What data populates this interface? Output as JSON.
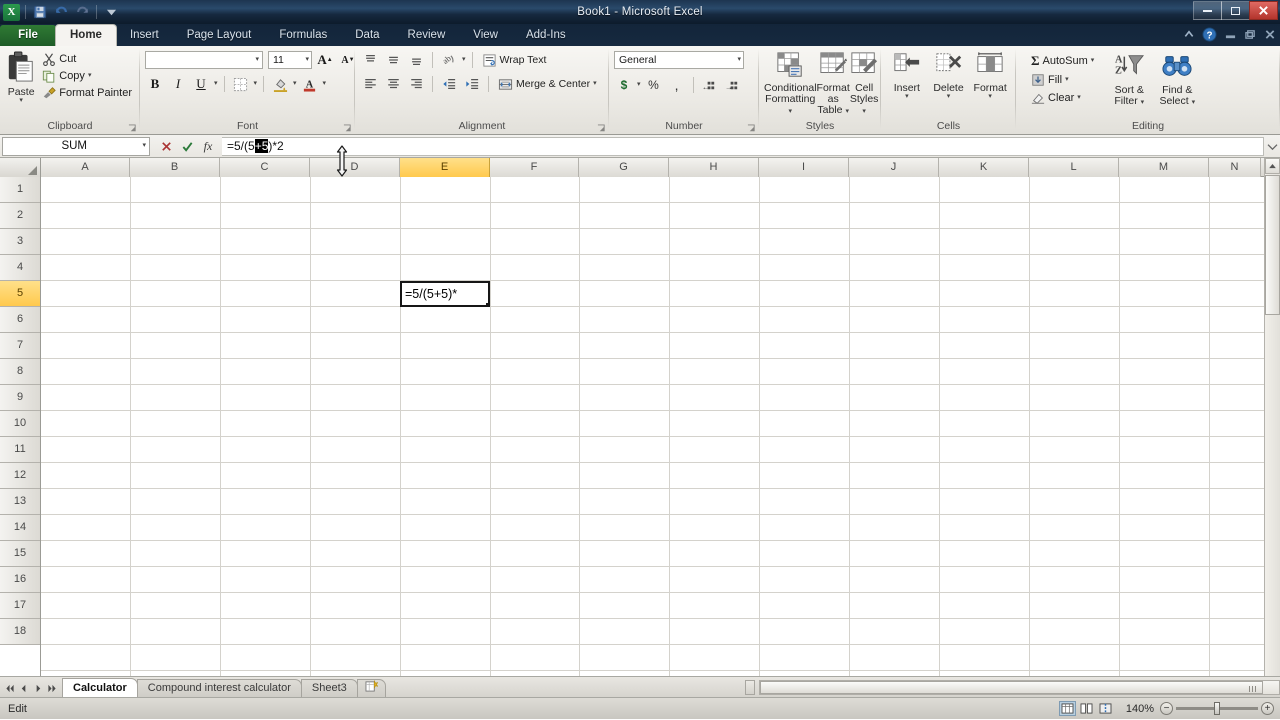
{
  "window": {
    "title": "Book1 - Microsoft Excel",
    "minimize": "–",
    "restore": "❐",
    "close": "✕"
  },
  "qat": {
    "logo": "X",
    "items": [
      {
        "name": "save-icon",
        "label": "Save"
      },
      {
        "name": "undo-icon",
        "label": "Undo"
      },
      {
        "name": "redo-icon",
        "label": "Redo"
      },
      {
        "name": "customize-qat-icon",
        "label": "Customize Quick Access Toolbar"
      }
    ]
  },
  "ribbon_tabs": {
    "file": "File",
    "items": [
      {
        "label": "Home",
        "active": true
      },
      {
        "label": "Insert",
        "active": false
      },
      {
        "label": "Page Layout",
        "active": false
      },
      {
        "label": "Formulas",
        "active": false
      },
      {
        "label": "Data",
        "active": false
      },
      {
        "label": "Review",
        "active": false
      },
      {
        "label": "View",
        "active": false
      },
      {
        "label": "Add-Ins",
        "active": false
      }
    ],
    "right_icons": [
      {
        "name": "minimize-ribbon-icon",
        "label": "Minimize the Ribbon"
      },
      {
        "name": "help-icon",
        "label": "Microsoft Excel Help"
      },
      {
        "name": "workbook-minimize-icon",
        "label": "Minimize Window"
      },
      {
        "name": "workbook-restore-icon",
        "label": "Restore Window"
      },
      {
        "name": "workbook-close-icon",
        "label": "Close Window"
      }
    ]
  },
  "ribbon": {
    "clipboard": {
      "title": "Clipboard",
      "paste": "Paste",
      "cut": "Cut",
      "copy": "Copy",
      "format_painter": "Format Painter"
    },
    "font": {
      "title": "Font",
      "font_name": "",
      "font_size": "11",
      "grow_font": "A",
      "shrink_font": "A",
      "bold": "B",
      "italic": "I",
      "underline": "U"
    },
    "alignment": {
      "title": "Alignment",
      "wrap_text": "Wrap Text",
      "merge_center": "Merge & Center"
    },
    "number": {
      "title": "Number",
      "format": "General",
      "currency": "$",
      "percent": "%",
      "comma": ",",
      "increase_decimal": "Increase Decimal",
      "decrease_decimal": "Decrease Decimal"
    },
    "styles": {
      "title": "Styles",
      "conditional_formatting": "Conditional\nFormatting",
      "conditional_formatting_l1": "Conditional",
      "conditional_formatting_l2": "Formatting",
      "format_as_table_l1": "Format",
      "format_as_table_l2": "as Table",
      "cell_styles_l1": "Cell",
      "cell_styles_l2": "Styles"
    },
    "cells": {
      "title": "Cells",
      "insert": "Insert",
      "delete": "Delete",
      "format": "Format"
    },
    "editing": {
      "title": "Editing",
      "autosum": "AutoSum",
      "fill": "Fill",
      "clear": "Clear",
      "sort_filter_l1": "Sort &",
      "sort_filter_l2": "Filter",
      "find_select_l1": "Find &",
      "find_select_l2": "Select"
    }
  },
  "formula_bar": {
    "name_box": "SUM",
    "formula_prefix": "=5/(5",
    "formula_selected": "+5",
    "formula_suffix": ")*2",
    "full_formula": "=5/(5+5)*2",
    "cancel_icon": "✕",
    "enter_icon": "✓",
    "fx_icon": "fx"
  },
  "grid": {
    "columns": [
      "A",
      "B",
      "C",
      "D",
      "E",
      "F",
      "G",
      "H",
      "I",
      "J",
      "K",
      "L",
      "M",
      "N"
    ],
    "selected_column": "E",
    "rows": [
      "1",
      "2",
      "3",
      "4",
      "5",
      "6",
      "7",
      "8",
      "9",
      "10",
      "11",
      "12",
      "13",
      "14",
      "15",
      "16",
      "17",
      "18"
    ],
    "selected_row": "5",
    "active_cell": "E5",
    "active_cell_text": "=5/(5+5)*"
  },
  "sheet_tabs": {
    "nav": [
      "⏮",
      "◀",
      "▶",
      "⏭"
    ],
    "items": [
      {
        "label": "Calculator",
        "active": true
      },
      {
        "label": "Compound interest calculator",
        "active": false
      },
      {
        "label": "Sheet3",
        "active": false
      }
    ],
    "insert_sheet": "⊕"
  },
  "status_bar": {
    "mode": "Edit",
    "views": [
      {
        "name": "normal-view-icon",
        "label": "Normal",
        "active": true
      },
      {
        "name": "page-layout-view-icon",
        "label": "Page Layout",
        "active": false
      },
      {
        "name": "page-break-preview-icon",
        "label": "Page Break Preview",
        "active": false
      }
    ],
    "zoom": "140%",
    "zoom_out": "−",
    "zoom_in": "+"
  },
  "colors": {
    "accent_selection": "#ffc94d",
    "title_bar": "#1d3550",
    "file_tab_green": "#2f7a34",
    "close_red": "#b3342c"
  }
}
